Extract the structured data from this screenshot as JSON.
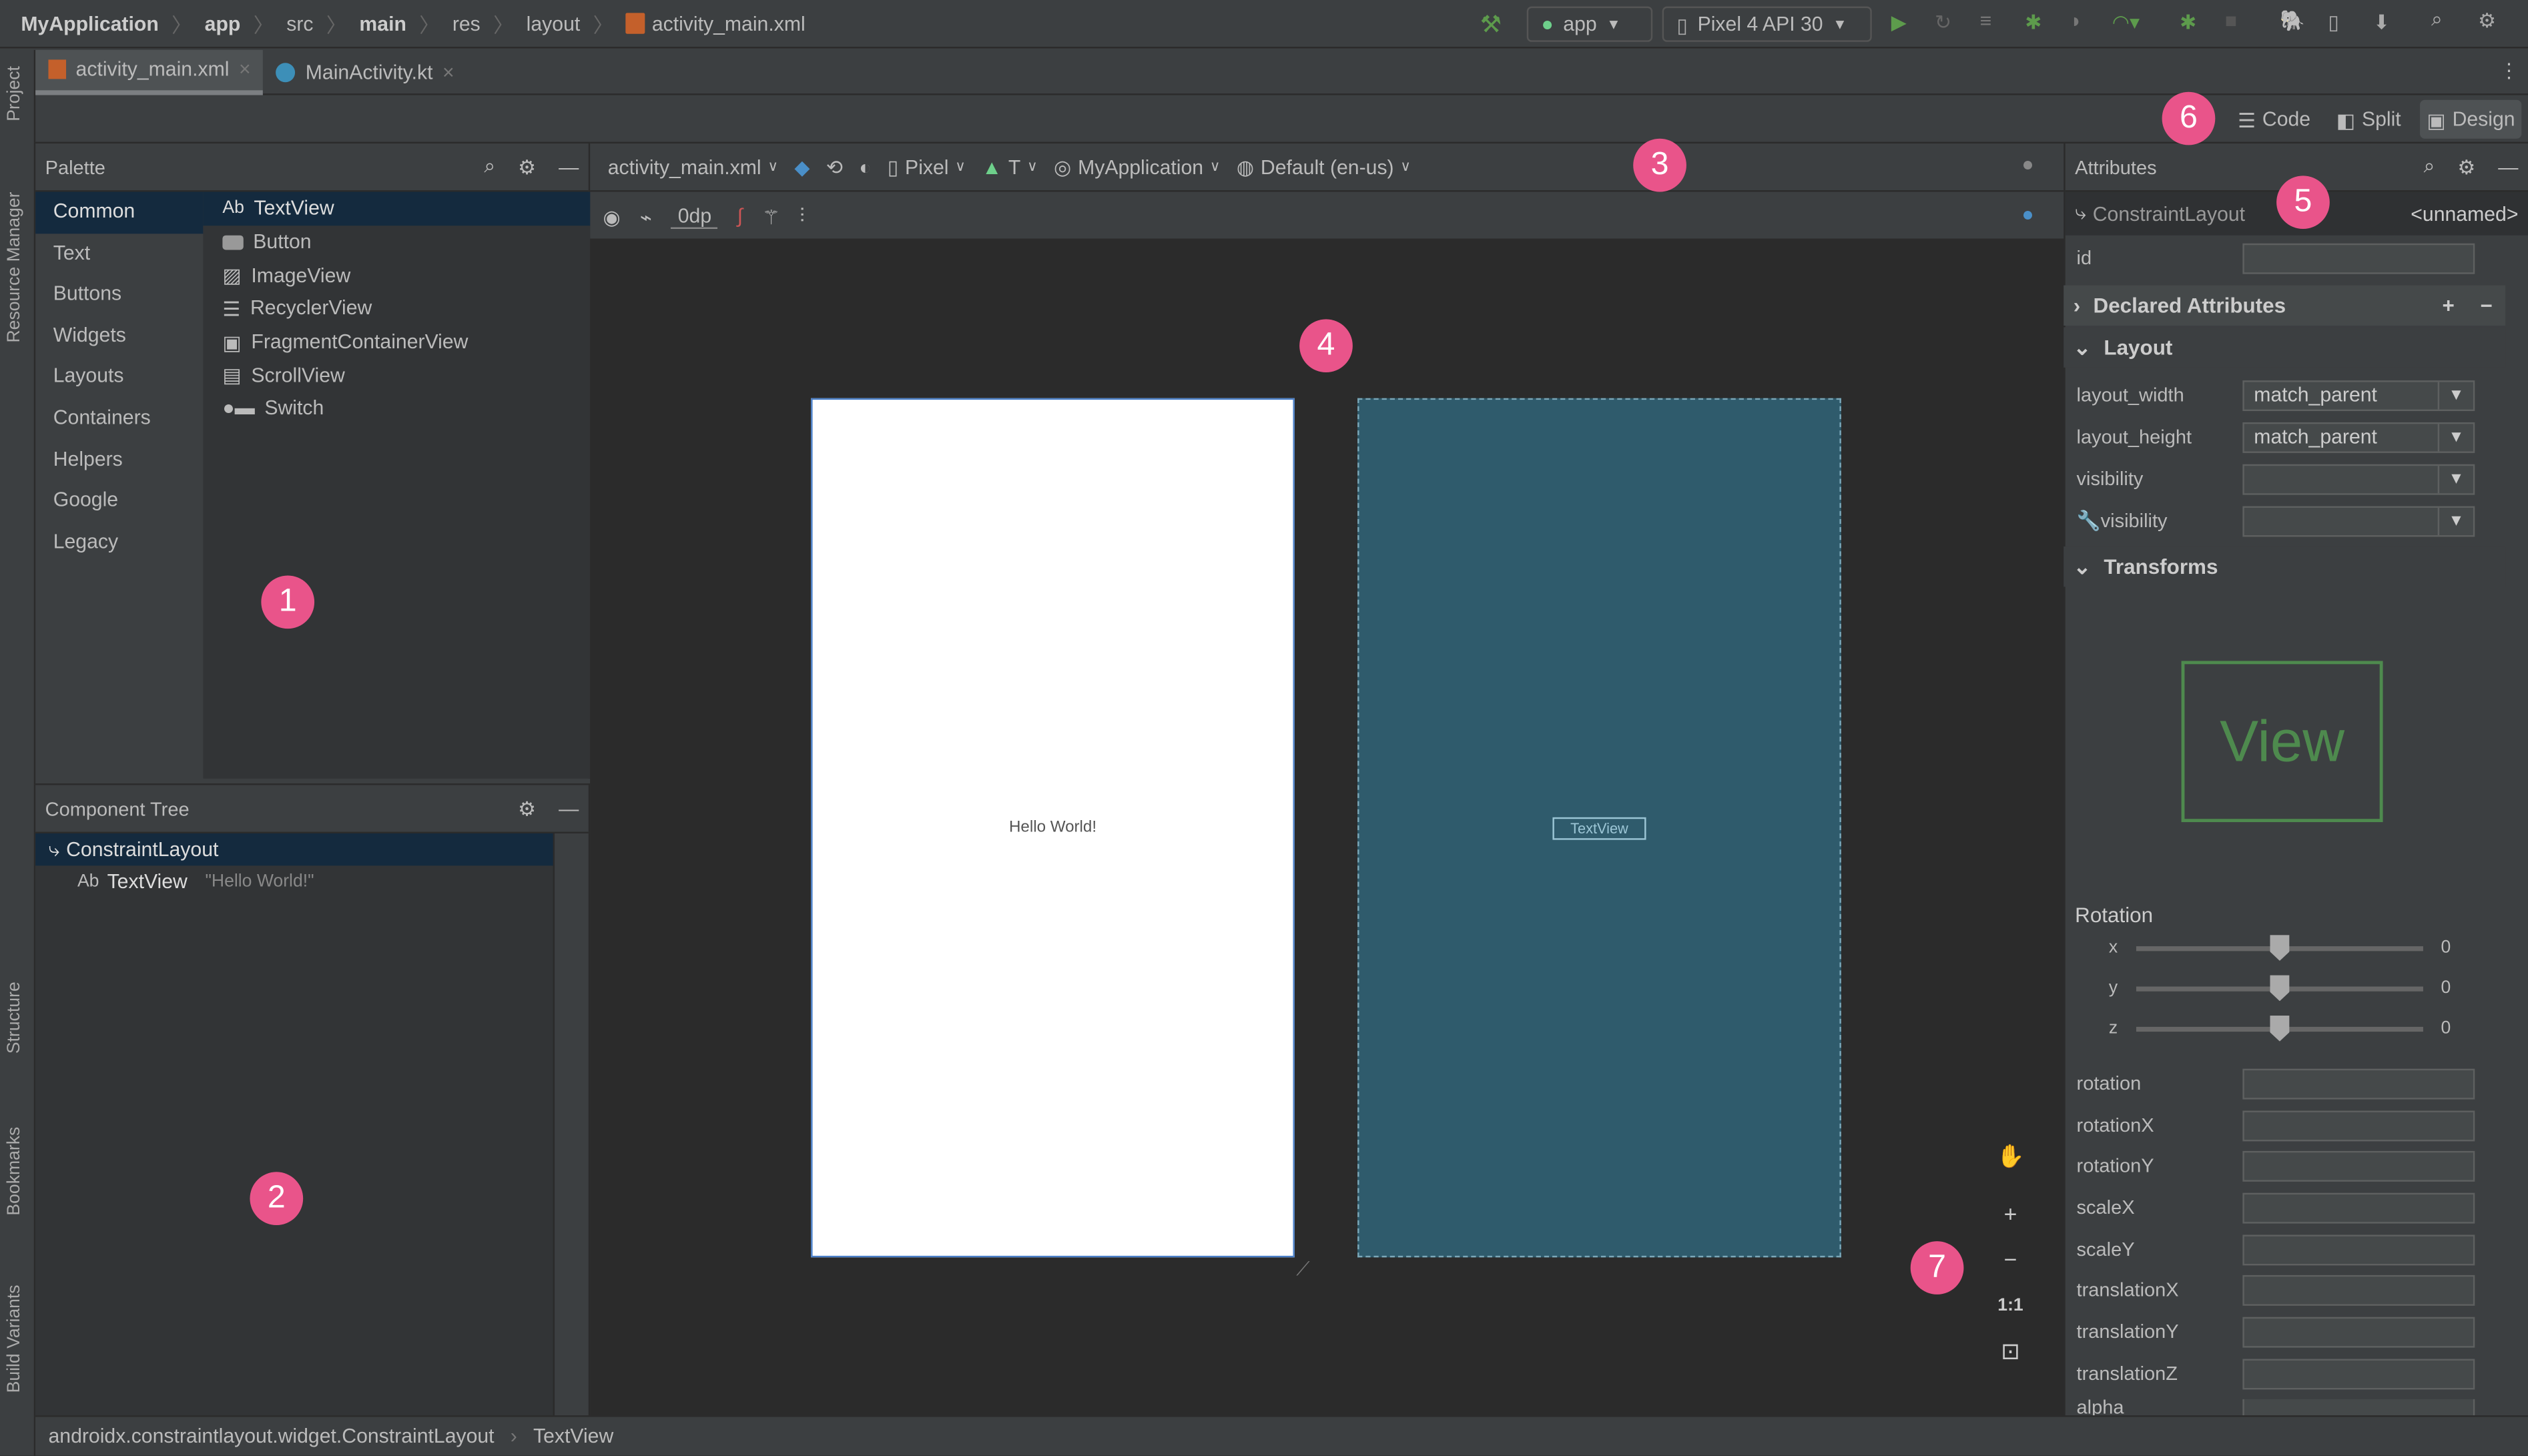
{
  "breadcrumb": [
    "MyApplication",
    "app",
    "src",
    "main",
    "res",
    "layout",
    "activity_main.xml"
  ],
  "toolbar": {
    "run_config": "app",
    "device": "Pixel 4 API 30"
  },
  "editor_tabs": [
    {
      "label": "activity_main.xml",
      "active": true
    },
    {
      "label": "MainActivity.kt",
      "active": false
    }
  ],
  "view_modes": {
    "code": "Code",
    "split": "Split",
    "design": "Design",
    "selected": "Design"
  },
  "side_tools": {
    "project": "Project",
    "resource_manager": "Resource Manager",
    "structure": "Structure",
    "bookmarks": "Bookmarks",
    "build_variants": "Build Variants"
  },
  "palette": {
    "title": "Palette",
    "categories": [
      "Common",
      "Text",
      "Buttons",
      "Widgets",
      "Layouts",
      "Containers",
      "Helpers",
      "Google",
      "Legacy"
    ],
    "selected_category": "Common",
    "items": [
      {
        "label": "TextView",
        "icon": "Ab"
      },
      {
        "label": "Button",
        "icon": "button-icon"
      },
      {
        "label": "ImageView",
        "icon": "image-icon"
      },
      {
        "label": "RecyclerView",
        "icon": "list-icon"
      },
      {
        "label": "FragmentContainerView",
        "icon": "fragment-icon"
      },
      {
        "label": "ScrollView",
        "icon": "scroll-icon"
      },
      {
        "label": "Switch",
        "icon": "switch-icon"
      }
    ]
  },
  "component_tree": {
    "title": "Component Tree",
    "root": "ConstraintLayout",
    "child_prefix": "Ab",
    "child": "TextView",
    "child_text": "\"Hello World!\""
  },
  "design_toolbar": {
    "file": "activity_main.xml",
    "device": "Pixel",
    "api": "T",
    "theme": "MyApplication",
    "locale": "Default (en-us)",
    "margin": "0dp"
  },
  "canvas": {
    "design_text": "Hello World!",
    "blueprint_text": "TextView",
    "blueprint_color": "#2f5b6c"
  },
  "attributes": {
    "title": "Attributes",
    "component": "ConstraintLayout",
    "name": "<unnamed>",
    "id_label": "id",
    "declared": "Declared Attributes",
    "layout": "Layout",
    "layout_rows": [
      {
        "label": "layout_width",
        "value": "match_parent"
      },
      {
        "label": "layout_height",
        "value": "match_parent"
      },
      {
        "label": "visibility",
        "value": ""
      },
      {
        "label": "visibility",
        "value": ""
      }
    ],
    "transforms": "Transforms",
    "preview": "View",
    "rotation_title": "Rotation",
    "rotation_sliders": [
      {
        "axis": "x",
        "value": "0"
      },
      {
        "axis": "y",
        "value": "0"
      },
      {
        "axis": "z",
        "value": "0"
      }
    ],
    "fields": [
      "rotation",
      "rotationX",
      "rotationY",
      "scaleX",
      "scaleY",
      "translationX",
      "translationY",
      "translationZ",
      "alpha"
    ]
  },
  "zoom": {
    "one_to_one": "1:1"
  },
  "status_bar": {
    "path": [
      "androidx.constraintlayout.widget.ConstraintLayout",
      "TextView"
    ]
  },
  "markers": [
    "1",
    "2",
    "3",
    "4",
    "5",
    "6",
    "7"
  ],
  "colors": {
    "accent_marker": "#e9548a",
    "selection": "#142a3e",
    "blueprint": "#2f5b6c"
  }
}
